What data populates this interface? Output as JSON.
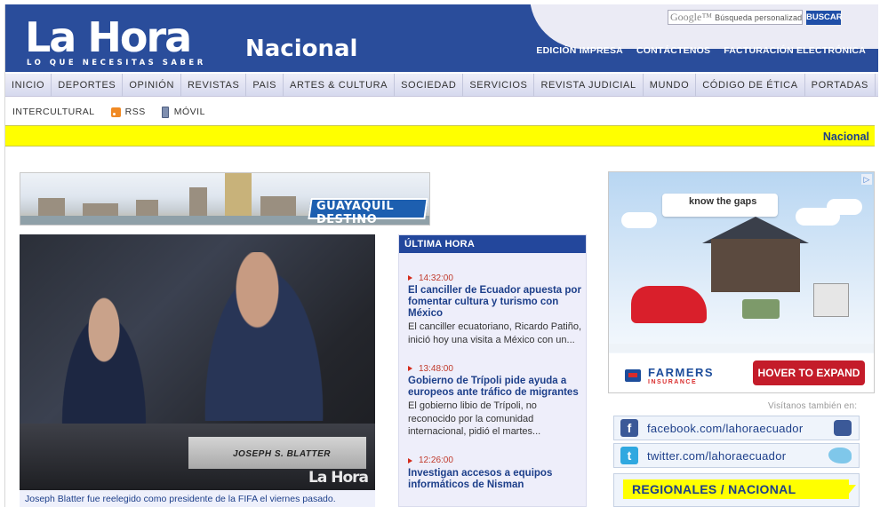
{
  "header": {
    "logo_text": "La Hora",
    "tagline": "LO QUE NECESITAS SABER",
    "section": "Nacional",
    "search_brand": "Google™",
    "search_placeholder": "Búsqueda personalizada",
    "search_button": "BUSCAR",
    "top_links": [
      "EDICIÓN IMPRESA",
      "CONTÁCTENOS",
      "FACTURACIÓN ELECTRÓNICA"
    ]
  },
  "nav": [
    "INICIO",
    "DEPORTES",
    "OPINIÓN",
    "REVISTAS",
    "PAIS",
    "ARTES & CULTURA",
    "SOCIEDAD",
    "SERVICIOS",
    "REVISTA JUDICIAL",
    "MUNDO",
    "CÓDIGO DE ÉTICA",
    "PORTADAS"
  ],
  "nav2": [
    "INTERCULTURAL",
    "RSS",
    "MÓVIL"
  ],
  "section_bar": "Nacional",
  "banner": {
    "brand": "GUAYAQUIL DESTINO"
  },
  "photo": {
    "nameplate": "JOSEPH S. BLATTER",
    "watermark": "La Hora",
    "caption": "Joseph Blatter fue reelegido como presidente de la FIFA el viernes pasado."
  },
  "ultima_hora": {
    "title": "ÚLTIMA HORA",
    "items": [
      {
        "time": "14:32:00",
        "headline": "El canciller de Ecuador apuesta por fomentar cultura y turismo con México",
        "summary": "El canciller ecuatoriano, Ricardo Patiño, inició hoy una visita a México con un..."
      },
      {
        "time": "13:48:00",
        "headline": "Gobierno de Trípoli pide ayuda a europeos ante tráfico de migrantes",
        "summary": "El gobierno libio de Trípoli, no reconocido por la comunidad internacional, pidió el martes..."
      },
      {
        "time": "12:26:00",
        "headline": "Investigan accesos a equipos informáticos de Nisman",
        "summary": ""
      }
    ]
  },
  "ad": {
    "headline": "know the gaps",
    "brand": "FARMERS",
    "brand_sub": "INSURANCE",
    "cta": "HOVER TO EXPAND"
  },
  "social": {
    "visit_label": "Visítanos también en:",
    "facebook": "facebook.com/lahoraecuador",
    "twitter": "twitter.com/lahoraecuador",
    "regionales": "REGIONALES / NACIONAL"
  },
  "colors": {
    "brand_blue": "#2a4d9b",
    "headline_blue": "#1d3f8a",
    "highlight_yellow": "#ffff00",
    "time_red": "#c0392b"
  }
}
